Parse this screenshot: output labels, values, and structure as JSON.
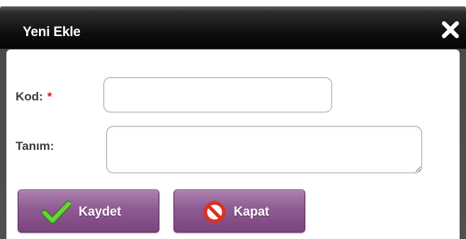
{
  "dialog": {
    "title": "Yeni Ekle",
    "close_icon": "close-icon"
  },
  "form": {
    "kod": {
      "label": "Kod:",
      "required_mark": "*",
      "value": ""
    },
    "tanim": {
      "label": "Tanım:",
      "value": ""
    }
  },
  "buttons": {
    "save": {
      "label": "Kaydet",
      "icon": "checkmark-icon"
    },
    "close": {
      "label": "Kapat",
      "icon": "prohibited-icon"
    }
  },
  "colors": {
    "titlebar": "#0d0d0d",
    "button": "#8f5a92",
    "required": "#d91515",
    "checkmark": "#52b52e",
    "prohibited": "#d9331f"
  }
}
